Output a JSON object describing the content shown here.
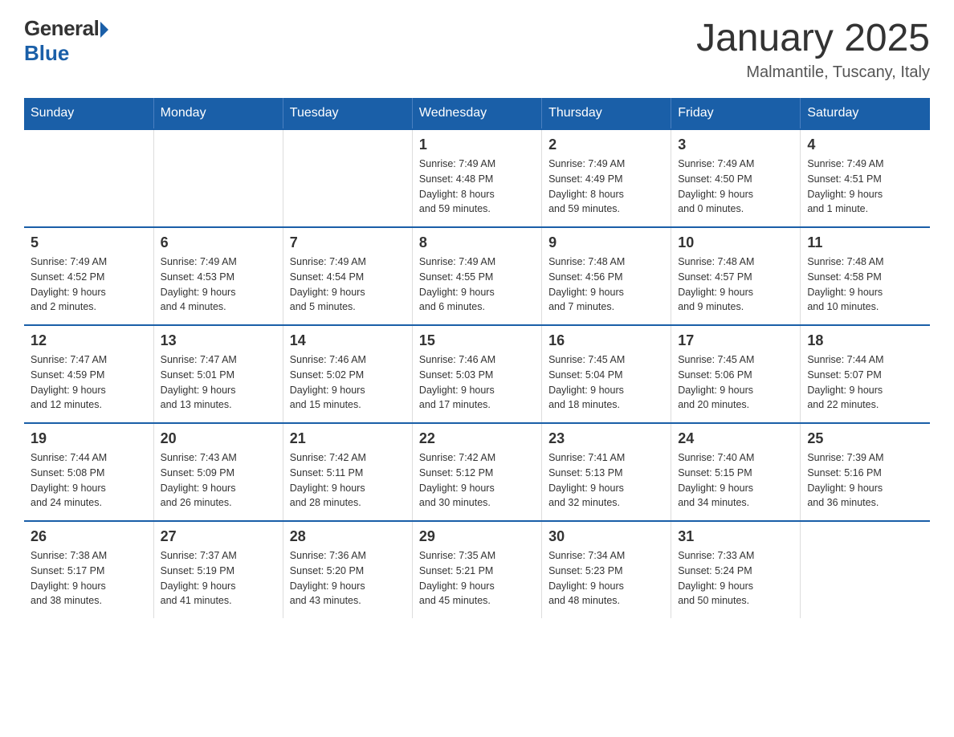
{
  "logo": {
    "general": "General",
    "blue": "Blue"
  },
  "title": "January 2025",
  "subtitle": "Malmantile, Tuscany, Italy",
  "weekdays": [
    "Sunday",
    "Monday",
    "Tuesday",
    "Wednesday",
    "Thursday",
    "Friday",
    "Saturday"
  ],
  "weeks": [
    [
      {
        "day": "",
        "info": ""
      },
      {
        "day": "",
        "info": ""
      },
      {
        "day": "",
        "info": ""
      },
      {
        "day": "1",
        "info": "Sunrise: 7:49 AM\nSunset: 4:48 PM\nDaylight: 8 hours\nand 59 minutes."
      },
      {
        "day": "2",
        "info": "Sunrise: 7:49 AM\nSunset: 4:49 PM\nDaylight: 8 hours\nand 59 minutes."
      },
      {
        "day": "3",
        "info": "Sunrise: 7:49 AM\nSunset: 4:50 PM\nDaylight: 9 hours\nand 0 minutes."
      },
      {
        "day": "4",
        "info": "Sunrise: 7:49 AM\nSunset: 4:51 PM\nDaylight: 9 hours\nand 1 minute."
      }
    ],
    [
      {
        "day": "5",
        "info": "Sunrise: 7:49 AM\nSunset: 4:52 PM\nDaylight: 9 hours\nand 2 minutes."
      },
      {
        "day": "6",
        "info": "Sunrise: 7:49 AM\nSunset: 4:53 PM\nDaylight: 9 hours\nand 4 minutes."
      },
      {
        "day": "7",
        "info": "Sunrise: 7:49 AM\nSunset: 4:54 PM\nDaylight: 9 hours\nand 5 minutes."
      },
      {
        "day": "8",
        "info": "Sunrise: 7:49 AM\nSunset: 4:55 PM\nDaylight: 9 hours\nand 6 minutes."
      },
      {
        "day": "9",
        "info": "Sunrise: 7:48 AM\nSunset: 4:56 PM\nDaylight: 9 hours\nand 7 minutes."
      },
      {
        "day": "10",
        "info": "Sunrise: 7:48 AM\nSunset: 4:57 PM\nDaylight: 9 hours\nand 9 minutes."
      },
      {
        "day": "11",
        "info": "Sunrise: 7:48 AM\nSunset: 4:58 PM\nDaylight: 9 hours\nand 10 minutes."
      }
    ],
    [
      {
        "day": "12",
        "info": "Sunrise: 7:47 AM\nSunset: 4:59 PM\nDaylight: 9 hours\nand 12 minutes."
      },
      {
        "day": "13",
        "info": "Sunrise: 7:47 AM\nSunset: 5:01 PM\nDaylight: 9 hours\nand 13 minutes."
      },
      {
        "day": "14",
        "info": "Sunrise: 7:46 AM\nSunset: 5:02 PM\nDaylight: 9 hours\nand 15 minutes."
      },
      {
        "day": "15",
        "info": "Sunrise: 7:46 AM\nSunset: 5:03 PM\nDaylight: 9 hours\nand 17 minutes."
      },
      {
        "day": "16",
        "info": "Sunrise: 7:45 AM\nSunset: 5:04 PM\nDaylight: 9 hours\nand 18 minutes."
      },
      {
        "day": "17",
        "info": "Sunrise: 7:45 AM\nSunset: 5:06 PM\nDaylight: 9 hours\nand 20 minutes."
      },
      {
        "day": "18",
        "info": "Sunrise: 7:44 AM\nSunset: 5:07 PM\nDaylight: 9 hours\nand 22 minutes."
      }
    ],
    [
      {
        "day": "19",
        "info": "Sunrise: 7:44 AM\nSunset: 5:08 PM\nDaylight: 9 hours\nand 24 minutes."
      },
      {
        "day": "20",
        "info": "Sunrise: 7:43 AM\nSunset: 5:09 PM\nDaylight: 9 hours\nand 26 minutes."
      },
      {
        "day": "21",
        "info": "Sunrise: 7:42 AM\nSunset: 5:11 PM\nDaylight: 9 hours\nand 28 minutes."
      },
      {
        "day": "22",
        "info": "Sunrise: 7:42 AM\nSunset: 5:12 PM\nDaylight: 9 hours\nand 30 minutes."
      },
      {
        "day": "23",
        "info": "Sunrise: 7:41 AM\nSunset: 5:13 PM\nDaylight: 9 hours\nand 32 minutes."
      },
      {
        "day": "24",
        "info": "Sunrise: 7:40 AM\nSunset: 5:15 PM\nDaylight: 9 hours\nand 34 minutes."
      },
      {
        "day": "25",
        "info": "Sunrise: 7:39 AM\nSunset: 5:16 PM\nDaylight: 9 hours\nand 36 minutes."
      }
    ],
    [
      {
        "day": "26",
        "info": "Sunrise: 7:38 AM\nSunset: 5:17 PM\nDaylight: 9 hours\nand 38 minutes."
      },
      {
        "day": "27",
        "info": "Sunrise: 7:37 AM\nSunset: 5:19 PM\nDaylight: 9 hours\nand 41 minutes."
      },
      {
        "day": "28",
        "info": "Sunrise: 7:36 AM\nSunset: 5:20 PM\nDaylight: 9 hours\nand 43 minutes."
      },
      {
        "day": "29",
        "info": "Sunrise: 7:35 AM\nSunset: 5:21 PM\nDaylight: 9 hours\nand 45 minutes."
      },
      {
        "day": "30",
        "info": "Sunrise: 7:34 AM\nSunset: 5:23 PM\nDaylight: 9 hours\nand 48 minutes."
      },
      {
        "day": "31",
        "info": "Sunrise: 7:33 AM\nSunset: 5:24 PM\nDaylight: 9 hours\nand 50 minutes."
      },
      {
        "day": "",
        "info": ""
      }
    ]
  ]
}
